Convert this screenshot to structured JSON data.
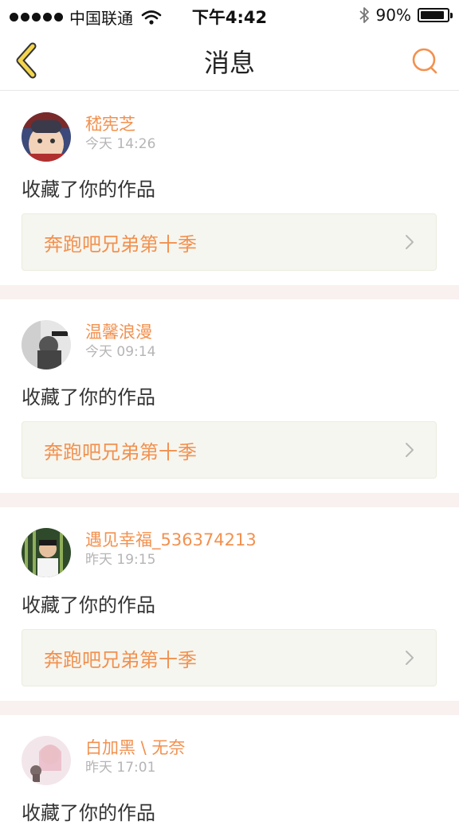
{
  "status_bar": {
    "carrier": "中国联通",
    "time": "下午4:42",
    "battery": "90%",
    "battery_level": 0.9,
    "icons": [
      "signal-dots-icon",
      "wifi-icon",
      "bluetooth-icon",
      "battery-icon"
    ]
  },
  "nav": {
    "title": "消息",
    "back_icon": "chevron-left-icon",
    "search_icon": "search-icon"
  },
  "colors": {
    "accent": "#f2914f",
    "nav_back": "#f3d54e",
    "divider": "#f8f1f0",
    "box_bg": "#f6f6f0"
  },
  "messages": [
    {
      "username": "嵇宪芝",
      "time": "今天 14:26",
      "action": "收藏了你的作品",
      "work": "奔跑吧兄弟第十季"
    },
    {
      "username": "温馨浪漫",
      "time": "今天 09:14",
      "action": "收藏了你的作品",
      "work": "奔跑吧兄弟第十季"
    },
    {
      "username": "遇见幸福_536374213",
      "time": "昨天 19:15",
      "action": "收藏了你的作品",
      "work": "奔跑吧兄弟第十季"
    },
    {
      "username": "白加黑 \\ 无奈",
      "time": "昨天 17:01",
      "action": "收藏了你的作品",
      "work": ""
    }
  ]
}
